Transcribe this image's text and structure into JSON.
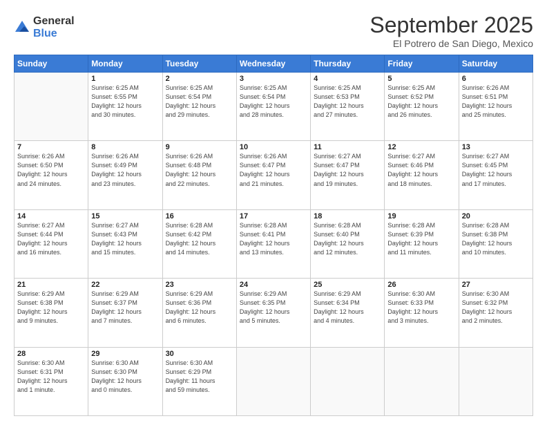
{
  "logo": {
    "general": "General",
    "blue": "Blue"
  },
  "header": {
    "month": "September 2025",
    "location": "El Potrero de San Diego, Mexico"
  },
  "weekdays": [
    "Sunday",
    "Monday",
    "Tuesday",
    "Wednesday",
    "Thursday",
    "Friday",
    "Saturday"
  ],
  "weeks": [
    [
      {
        "day": "",
        "info": ""
      },
      {
        "day": "1",
        "info": "Sunrise: 6:25 AM\nSunset: 6:55 PM\nDaylight: 12 hours\nand 30 minutes."
      },
      {
        "day": "2",
        "info": "Sunrise: 6:25 AM\nSunset: 6:54 PM\nDaylight: 12 hours\nand 29 minutes."
      },
      {
        "day": "3",
        "info": "Sunrise: 6:25 AM\nSunset: 6:54 PM\nDaylight: 12 hours\nand 28 minutes."
      },
      {
        "day": "4",
        "info": "Sunrise: 6:25 AM\nSunset: 6:53 PM\nDaylight: 12 hours\nand 27 minutes."
      },
      {
        "day": "5",
        "info": "Sunrise: 6:25 AM\nSunset: 6:52 PM\nDaylight: 12 hours\nand 26 minutes."
      },
      {
        "day": "6",
        "info": "Sunrise: 6:26 AM\nSunset: 6:51 PM\nDaylight: 12 hours\nand 25 minutes."
      }
    ],
    [
      {
        "day": "7",
        "info": "Sunrise: 6:26 AM\nSunset: 6:50 PM\nDaylight: 12 hours\nand 24 minutes."
      },
      {
        "day": "8",
        "info": "Sunrise: 6:26 AM\nSunset: 6:49 PM\nDaylight: 12 hours\nand 23 minutes."
      },
      {
        "day": "9",
        "info": "Sunrise: 6:26 AM\nSunset: 6:48 PM\nDaylight: 12 hours\nand 22 minutes."
      },
      {
        "day": "10",
        "info": "Sunrise: 6:26 AM\nSunset: 6:47 PM\nDaylight: 12 hours\nand 21 minutes."
      },
      {
        "day": "11",
        "info": "Sunrise: 6:27 AM\nSunset: 6:47 PM\nDaylight: 12 hours\nand 19 minutes."
      },
      {
        "day": "12",
        "info": "Sunrise: 6:27 AM\nSunset: 6:46 PM\nDaylight: 12 hours\nand 18 minutes."
      },
      {
        "day": "13",
        "info": "Sunrise: 6:27 AM\nSunset: 6:45 PM\nDaylight: 12 hours\nand 17 minutes."
      }
    ],
    [
      {
        "day": "14",
        "info": "Sunrise: 6:27 AM\nSunset: 6:44 PM\nDaylight: 12 hours\nand 16 minutes."
      },
      {
        "day": "15",
        "info": "Sunrise: 6:27 AM\nSunset: 6:43 PM\nDaylight: 12 hours\nand 15 minutes."
      },
      {
        "day": "16",
        "info": "Sunrise: 6:28 AM\nSunset: 6:42 PM\nDaylight: 12 hours\nand 14 minutes."
      },
      {
        "day": "17",
        "info": "Sunrise: 6:28 AM\nSunset: 6:41 PM\nDaylight: 12 hours\nand 13 minutes."
      },
      {
        "day": "18",
        "info": "Sunrise: 6:28 AM\nSunset: 6:40 PM\nDaylight: 12 hours\nand 12 minutes."
      },
      {
        "day": "19",
        "info": "Sunrise: 6:28 AM\nSunset: 6:39 PM\nDaylight: 12 hours\nand 11 minutes."
      },
      {
        "day": "20",
        "info": "Sunrise: 6:28 AM\nSunset: 6:38 PM\nDaylight: 12 hours\nand 10 minutes."
      }
    ],
    [
      {
        "day": "21",
        "info": "Sunrise: 6:29 AM\nSunset: 6:38 PM\nDaylight: 12 hours\nand 9 minutes."
      },
      {
        "day": "22",
        "info": "Sunrise: 6:29 AM\nSunset: 6:37 PM\nDaylight: 12 hours\nand 7 minutes."
      },
      {
        "day": "23",
        "info": "Sunrise: 6:29 AM\nSunset: 6:36 PM\nDaylight: 12 hours\nand 6 minutes."
      },
      {
        "day": "24",
        "info": "Sunrise: 6:29 AM\nSunset: 6:35 PM\nDaylight: 12 hours\nand 5 minutes."
      },
      {
        "day": "25",
        "info": "Sunrise: 6:29 AM\nSunset: 6:34 PM\nDaylight: 12 hours\nand 4 minutes."
      },
      {
        "day": "26",
        "info": "Sunrise: 6:30 AM\nSunset: 6:33 PM\nDaylight: 12 hours\nand 3 minutes."
      },
      {
        "day": "27",
        "info": "Sunrise: 6:30 AM\nSunset: 6:32 PM\nDaylight: 12 hours\nand 2 minutes."
      }
    ],
    [
      {
        "day": "28",
        "info": "Sunrise: 6:30 AM\nSunset: 6:31 PM\nDaylight: 12 hours\nand 1 minute."
      },
      {
        "day": "29",
        "info": "Sunrise: 6:30 AM\nSunset: 6:30 PM\nDaylight: 12 hours\nand 0 minutes."
      },
      {
        "day": "30",
        "info": "Sunrise: 6:30 AM\nSunset: 6:29 PM\nDaylight: 11 hours\nand 59 minutes."
      },
      {
        "day": "",
        "info": ""
      },
      {
        "day": "",
        "info": ""
      },
      {
        "day": "",
        "info": ""
      },
      {
        "day": "",
        "info": ""
      }
    ]
  ]
}
